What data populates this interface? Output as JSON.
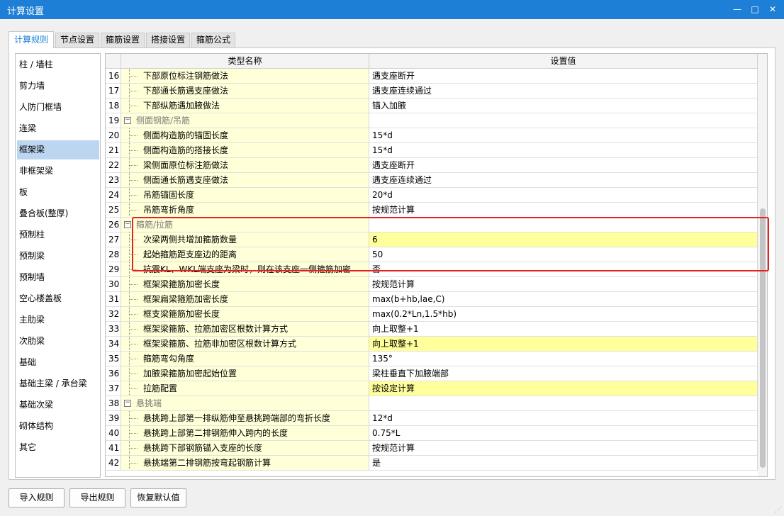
{
  "window": {
    "title": "计算设置",
    "minimize_label": "—",
    "maximize_label": "□",
    "close_label": "✕"
  },
  "tabs": [
    {
      "label": "计算规则",
      "active": true
    },
    {
      "label": "节点设置",
      "active": false
    },
    {
      "label": "箍筋设置",
      "active": false
    },
    {
      "label": "搭接设置",
      "active": false
    },
    {
      "label": "箍筋公式",
      "active": false
    }
  ],
  "sidebar": {
    "items": [
      {
        "label": "柱 / 墙柱"
      },
      {
        "label": "剪力墙"
      },
      {
        "label": "人防门框墙"
      },
      {
        "label": "连梁"
      },
      {
        "label": "框架梁",
        "selected": true
      },
      {
        "label": "非框架梁"
      },
      {
        "label": "板"
      },
      {
        "label": "叠合板(整厚)"
      },
      {
        "label": "预制柱"
      },
      {
        "label": "预制梁"
      },
      {
        "label": "预制墙"
      },
      {
        "label": "空心楼盖板"
      },
      {
        "label": "主肋梁"
      },
      {
        "label": "次肋梁"
      },
      {
        "label": "基础"
      },
      {
        "label": "基础主梁 / 承台梁"
      },
      {
        "label": "基础次梁"
      },
      {
        "label": "砌体结构"
      },
      {
        "label": "其它"
      }
    ]
  },
  "grid": {
    "headers": {
      "name": "类型名称",
      "value": "设置值"
    },
    "rows": [
      {
        "num": "16",
        "name": "下部原位标注钢筋做法",
        "value": "遇支座断开"
      },
      {
        "num": "17",
        "name": "下部通长筋遇支座做法",
        "value": "遇支座连续通过"
      },
      {
        "num": "18",
        "name": "下部纵筋遇加腋做法",
        "value": "锚入加腋"
      },
      {
        "num": "19",
        "name": "侧面钢筋/吊筋",
        "value": "",
        "group": true
      },
      {
        "num": "20",
        "name": "侧面构造筋的锚固长度",
        "value": "15*d"
      },
      {
        "num": "21",
        "name": "侧面构造筋的搭接长度",
        "value": "15*d"
      },
      {
        "num": "22",
        "name": "梁侧面原位标注筋做法",
        "value": "遇支座断开"
      },
      {
        "num": "23",
        "name": "侧面通长筋遇支座做法",
        "value": "遇支座连续通过"
      },
      {
        "num": "24",
        "name": "吊筋锚固长度",
        "value": "20*d"
      },
      {
        "num": "25",
        "name": "吊筋弯折角度",
        "value": "按规范计算"
      },
      {
        "num": "26",
        "name": "箍筋/拉筋",
        "value": "",
        "group": true
      },
      {
        "num": "27",
        "name": "次梁两侧共增加箍筋数量",
        "value": "6",
        "highlight": true
      },
      {
        "num": "28",
        "name": "起始箍筋距支座边的距离",
        "value": "50"
      },
      {
        "num": "29",
        "name": "抗震KL、WKL端支座为梁时，则在该支座一侧箍筋加密",
        "value": "否"
      },
      {
        "num": "30",
        "name": "框架梁箍筋加密长度",
        "value": "按规范计算"
      },
      {
        "num": "31",
        "name": "框架扁梁箍筋加密长度",
        "value": "max(b+hb,lae,C)"
      },
      {
        "num": "32",
        "name": "框支梁箍筋加密长度",
        "value": "max(0.2*Ln,1.5*hb)"
      },
      {
        "num": "33",
        "name": "框架梁箍筋、拉筋加密区根数计算方式",
        "value": "向上取整+1"
      },
      {
        "num": "34",
        "name": "框架梁箍筋、拉筋非加密区根数计算方式",
        "value": "向上取整+1",
        "highlight": true
      },
      {
        "num": "35",
        "name": "箍筋弯勾角度",
        "value": "135°"
      },
      {
        "num": "36",
        "name": "加腋梁箍筋加密起始位置",
        "value": "梁柱垂直下加腋端部"
      },
      {
        "num": "37",
        "name": "拉筋配置",
        "value": "按设定计算",
        "highlight": true
      },
      {
        "num": "38",
        "name": "悬挑端",
        "value": "",
        "group": true
      },
      {
        "num": "39",
        "name": "悬挑跨上部第一排纵筋伸至悬挑跨端部的弯折长度",
        "value": "12*d"
      },
      {
        "num": "40",
        "name": "悬挑跨上部第二排钢筋伸入跨内的长度",
        "value": "0.75*L"
      },
      {
        "num": "41",
        "name": "悬挑跨下部钢筋锚入支座的长度",
        "value": "按规范计算"
      },
      {
        "num": "42",
        "name": "悬挑端第二排钢筋按弯起钢筋计算",
        "value": "是"
      }
    ]
  },
  "buttons": {
    "import": "导入规则",
    "export": "导出规则",
    "restore": "恢复默认值"
  },
  "colors": {
    "titlebar": "#1e7fd6",
    "name_cell": "#ffffd8",
    "value_highlight": "#ffff9b",
    "annotation": "#e52121"
  }
}
